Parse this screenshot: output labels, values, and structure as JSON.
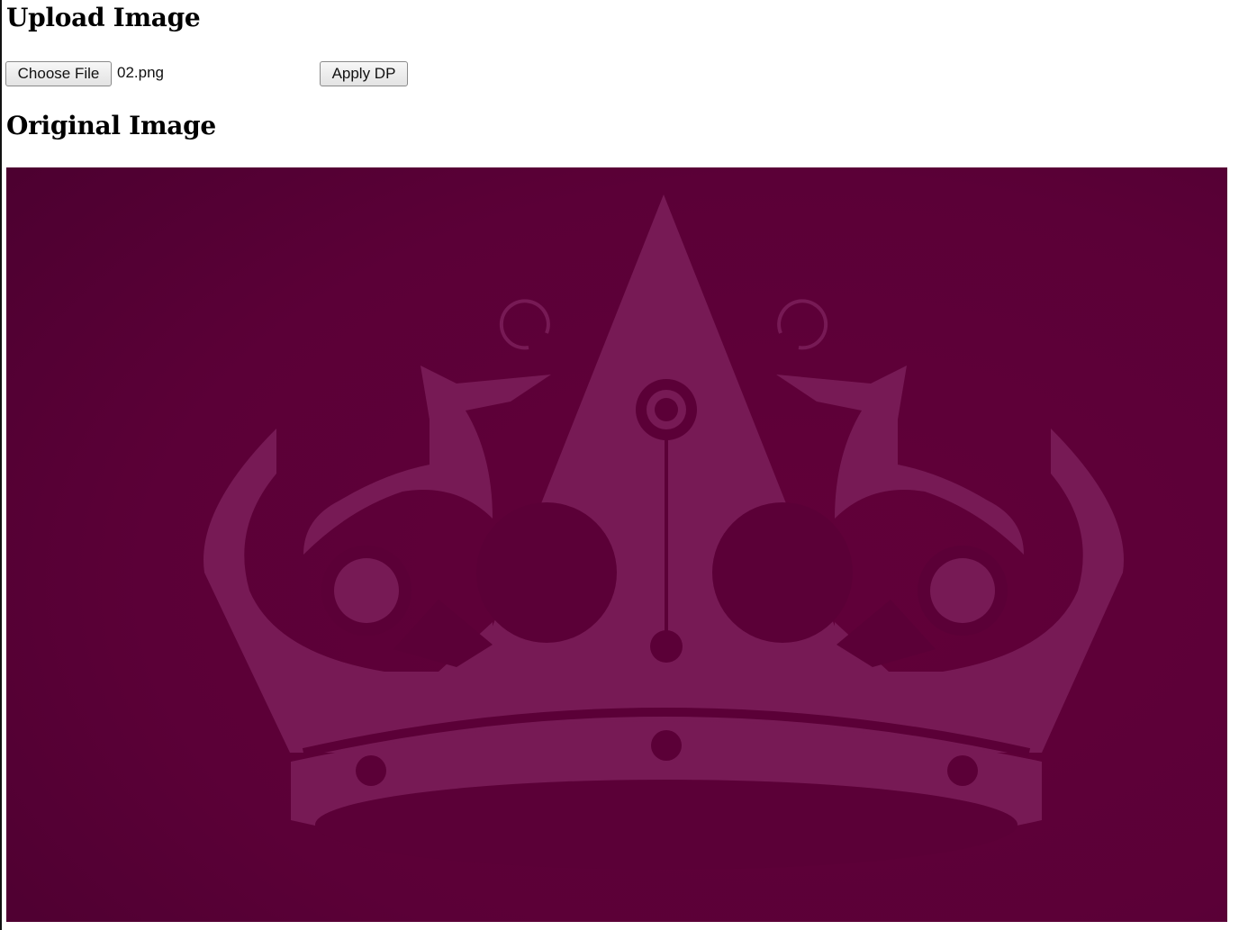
{
  "upload": {
    "title": "Upload Image",
    "choose_file_label": "Choose File",
    "file_name": "02.png",
    "apply_label": "Apply DP"
  },
  "original": {
    "title": "Original Image"
  },
  "colors": {
    "background": "#5b0036",
    "crown": "#771a55"
  }
}
